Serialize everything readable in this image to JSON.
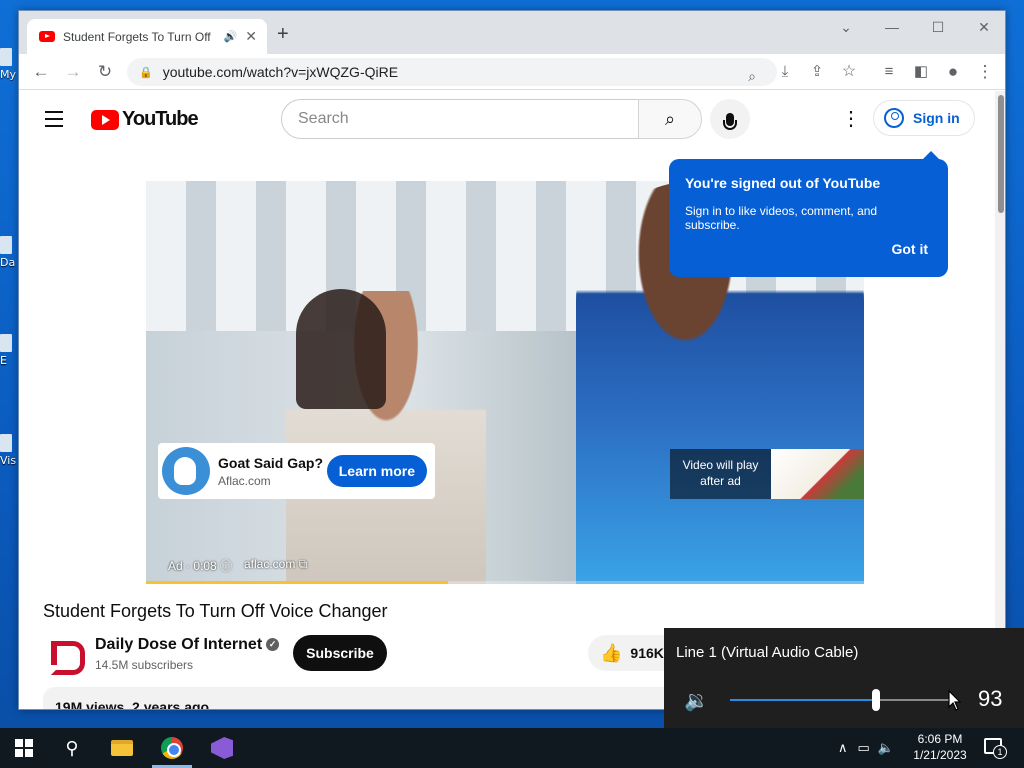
{
  "desktop": {
    "icons": [
      {
        "label": "My"
      },
      {
        "label": "Da"
      },
      {
        "label": "E"
      },
      {
        "label": "Vis"
      }
    ]
  },
  "browser": {
    "tab": {
      "title": "Student Forgets To Turn Off",
      "audio_icon": "speaker-icon",
      "close": "✕"
    },
    "new_tab": "+",
    "window_controls": {
      "dropdown": "⌄",
      "minimize": "—",
      "maximize": "☐",
      "close": "✕"
    },
    "nav": {
      "back": "←",
      "forward": "→",
      "reload": "↻"
    },
    "url": "youtube.com/watch?v=jxWQZG-QiRE",
    "omnibox_icons": [
      "zoom-icon",
      "install-icon",
      "share-icon",
      "bookmark-star-icon"
    ],
    "toolbar_icons": [
      "media-controls-icon",
      "side-panel-icon",
      "profile-icon",
      "menu-icon"
    ]
  },
  "youtube": {
    "logo_text": "YouTube",
    "search_placeholder": "Search",
    "sign_in": "Sign in",
    "popup": {
      "heading": "You're signed out of YouTube",
      "body": "Sign in to like videos, comment, and subscribe.",
      "button": "Got it"
    },
    "ad": {
      "title": "Goat Said Gap?",
      "domain": "Aflac.com",
      "cta": "Learn more",
      "info": "Ad · 0:08 ⓘ",
      "link": "aflac.com ⧉",
      "next_label": "Video will play after ad",
      "progress_fraction": 0.42
    },
    "video": {
      "title": "Student Forgets To Turn Off Voice Changer",
      "channel": "Daily Dose Of Internet",
      "subscribers": "14.5M subscribers",
      "subscribe": "Subscribe",
      "likes": "916K",
      "views": "19M views",
      "age": "2 years ago"
    }
  },
  "volume_flyout": {
    "device": "Line 1 (Virtual Audio Cable)",
    "value": "93",
    "level_fraction": 0.93,
    "accent": "#2b8be0"
  },
  "taskbar": {
    "time": "6:06 PM",
    "date": "1/21/2023",
    "notifications": "1"
  }
}
